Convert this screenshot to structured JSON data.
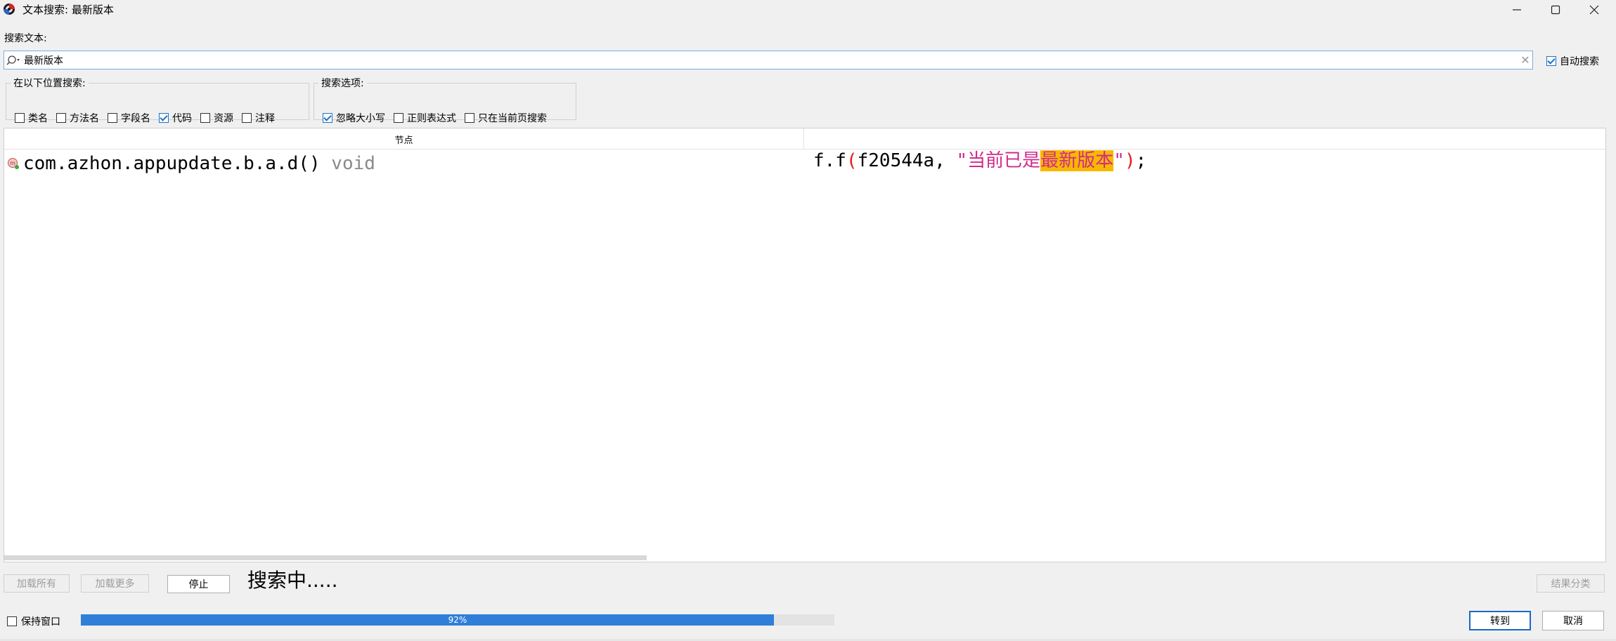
{
  "window": {
    "title": "文本搜索: 最新版本",
    "icons": {
      "app": "app-logo-icon",
      "minimize": "minimize-icon",
      "maximize": "maximize-icon",
      "close": "close-icon"
    }
  },
  "search": {
    "label": "搜索文本:",
    "value": "最新版本",
    "auto_search_label": "自动搜索",
    "auto_search_checked": true
  },
  "location_group": {
    "legend": "在以下位置搜索:",
    "options": [
      {
        "label": "类名",
        "checked": false
      },
      {
        "label": "方法名",
        "checked": false
      },
      {
        "label": "字段名",
        "checked": false
      },
      {
        "label": "代码",
        "checked": true
      },
      {
        "label": "资源",
        "checked": false
      },
      {
        "label": "注释",
        "checked": false
      }
    ]
  },
  "options_group": {
    "legend": "搜索选项:",
    "options": [
      {
        "label": "忽略大小写",
        "checked": true
      },
      {
        "label": "正则表达式",
        "checked": false
      },
      {
        "label": "只在当前页搜索",
        "checked": false
      }
    ]
  },
  "results": {
    "column_node": "节点",
    "rows": [
      {
        "node": "com.azhon.appupdate.b.a.d()",
        "type": "void",
        "code_prefix": "f.f",
        "code_open": "(",
        "code_arg": "f20544a, ",
        "code_str_start": "\"当前已是",
        "code_highlight": "最新版本",
        "code_str_end": "\"",
        "code_close": ")",
        "code_suffix": ";"
      }
    ]
  },
  "buttons": {
    "load_all": "加载所有",
    "load_more": "加载更多",
    "stop": "停止",
    "categorize": "结果分类",
    "goto": "转到",
    "cancel": "取消"
  },
  "status": "搜索中.....",
  "keep_window": {
    "label": "保持窗口",
    "checked": false
  },
  "progress": {
    "value": 0.92,
    "label": "92%"
  },
  "colors": {
    "accent": "#2f7fd8",
    "highlight": "#f8b800",
    "string": "#d12a8c",
    "paren": "#e21b1b"
  }
}
